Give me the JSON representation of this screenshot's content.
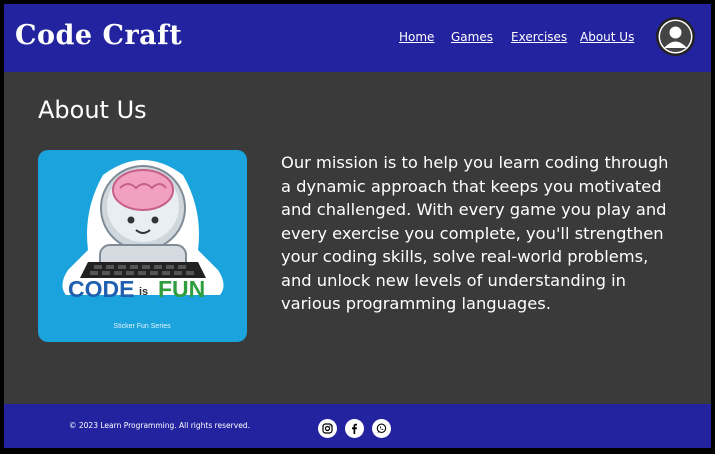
{
  "header": {
    "brand": "Code Craft",
    "nav": [
      {
        "label": "Home"
      },
      {
        "label": "Games"
      },
      {
        "label": "Exercises"
      },
      {
        "label": "About Us"
      }
    ],
    "avatar_icon": "user-avatar-icon"
  },
  "main": {
    "title": "About Us",
    "logo": {
      "text_code": "CODE",
      "text_is": "is",
      "text_fun": "FUN",
      "caption": "Sticker Fun Series"
    },
    "mission": "Our mission is to help you learn coding through a dynamic approach that keeps you motivated and challenged. With every game you play and every exercise you complete, you'll strengthen your coding skills, solve real-world problems, and unlock new levels of understanding in various programming languages."
  },
  "footer": {
    "copyright": "© 2023 Learn Programming. All rights reserved.",
    "social": [
      "instagram-icon",
      "facebook-icon",
      "whatsapp-icon"
    ]
  },
  "colors": {
    "header_bg": "#2323a0",
    "body_bg": "#3a3a3a",
    "logo_bg": "#1aa3dc"
  }
}
